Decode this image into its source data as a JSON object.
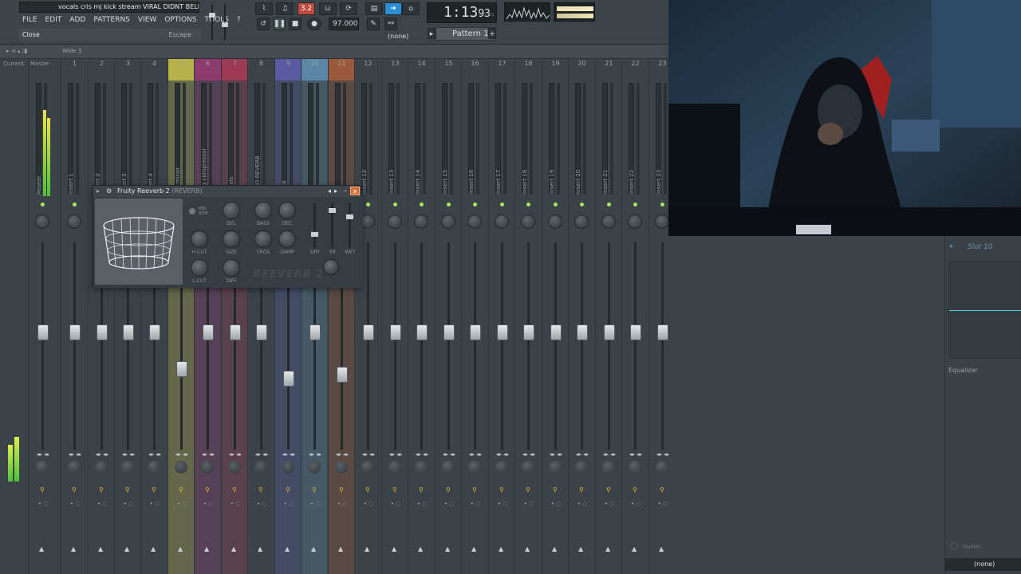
{
  "window": {
    "title": "vocals cris mj kick stream VIRAL DIDNT BELIVE I...",
    "min_label": "‒",
    "max_label": "□",
    "close_label": "✕"
  },
  "menu": [
    "FILE",
    "EDIT",
    "ADD",
    "PATTERNS",
    "VIEW",
    "OPTIONS",
    "TOOLS",
    "?"
  ],
  "hint": {
    "text": "Close",
    "shortcut": "Escape"
  },
  "transport": {
    "time": "1:13",
    "time_frac": "93",
    "time_unit": "M:S:CS",
    "tempo": "97.000",
    "snap_label": "3.2",
    "snap_none": "(none)",
    "pattern": "Pattern 1"
  },
  "mixer": {
    "wide_label": "Wide 3",
    "current_label": "Current",
    "master_label": "Master",
    "tracks": [
      {
        "num": "",
        "name": "Master",
        "color": "",
        "fader": 0.57
      },
      {
        "num": "1",
        "name": "Insert 1",
        "color": "",
        "fader": 0.57
      },
      {
        "num": "2",
        "name": "Insert 2",
        "color": "",
        "fader": 0.57
      },
      {
        "num": "3",
        "name": "Insert 3",
        "color": "",
        "fader": 0.57
      },
      {
        "num": "4",
        "name": "Insert 4",
        "color": "",
        "fader": 0.57
      },
      {
        "num": "5",
        "name": "m f minor",
        "color": "#b8b04a",
        "fader": 0.38
      },
      {
        "num": "6",
        "name": "ding compressor",
        "color": "#8c3b6e",
        "fader": 0.57
      },
      {
        "num": "7",
        "name": "Vocals",
        "color": "#9a3a55",
        "fader": 0.57
      },
      {
        "num": "8",
        "name": "ODIO REVERB",
        "color": "",
        "fader": 0.57
      },
      {
        "num": "9",
        "name": "BLER",
        "color": "#5a5aa0",
        "fader": 0.33
      },
      {
        "num": "10",
        "name": "RB",
        "color": "#5b86a6",
        "fader": 0.57
      },
      {
        "num": "11",
        "name": "Y 2",
        "color": "#9a5a3a",
        "fader": 0.35
      },
      {
        "num": "12",
        "name": "Insert 12",
        "color": "",
        "fader": 0.57
      },
      {
        "num": "13",
        "name": "Insert 13",
        "color": "",
        "fader": 0.57
      },
      {
        "num": "14",
        "name": "Insert 14",
        "color": "",
        "fader": 0.57
      },
      {
        "num": "15",
        "name": "Insert 15",
        "color": "",
        "fader": 0.57
      },
      {
        "num": "16",
        "name": "Insert 16",
        "color": "",
        "fader": 0.57
      },
      {
        "num": "17",
        "name": "Insert 17",
        "color": "",
        "fader": 0.57
      },
      {
        "num": "18",
        "name": "Insert 18",
        "color": "",
        "fader": 0.57
      },
      {
        "num": "19",
        "name": "Insert 19",
        "color": "",
        "fader": 0.57
      },
      {
        "num": "20",
        "name": "Insert 20",
        "color": "",
        "fader": 0.57
      },
      {
        "num": "21",
        "name": "Insert 21",
        "color": "",
        "fader": 0.57
      },
      {
        "num": "22",
        "name": "Insert 22",
        "color": "",
        "fader": 0.57
      },
      {
        "num": "23",
        "name": "Insert 23",
        "color": "",
        "fader": 0.57
      }
    ]
  },
  "plugin": {
    "title": "Fruity Reeverb 2",
    "subtitle": "(REVERB)",
    "logo": "REEVERB 2",
    "knob_labels": [
      "DEL",
      "BASS",
      "DEC",
      "H.CUT",
      "SIZE",
      "CROS",
      "DAMP",
      "L.CUT",
      "DIFF",
      "DRY",
      "ER",
      "WET"
    ],
    "mid_side": "MID SIDE",
    "close_label": "✕"
  },
  "right_panel": {
    "slot": "Slot 10",
    "eq_label": "Equalizer",
    "none_small": "(none)",
    "none_bottom": "(none)"
  }
}
